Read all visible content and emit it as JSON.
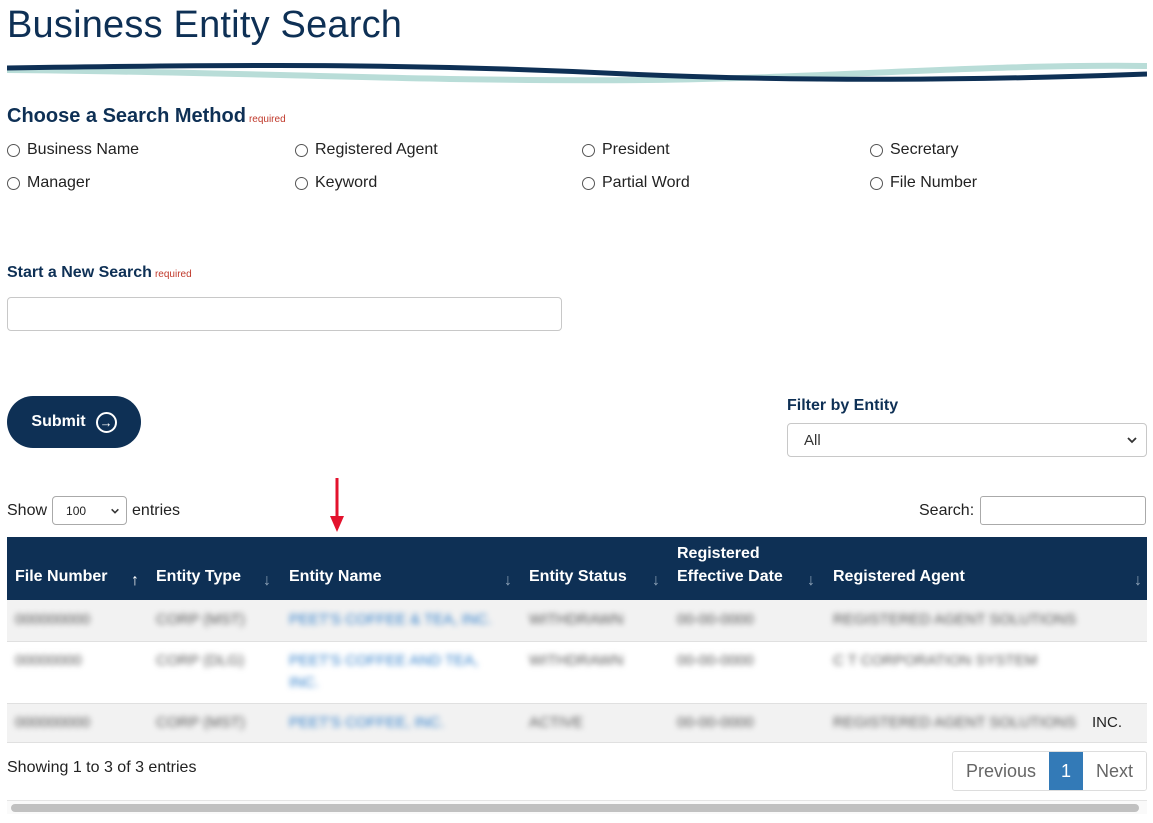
{
  "page": {
    "title": "Business Entity Search"
  },
  "search_method": {
    "title": "Choose a Search Method",
    "required": "required",
    "options": [
      "Business Name",
      "Registered Agent",
      "President",
      "Secretary",
      "Manager",
      "Keyword",
      "Partial Word",
      "File Number"
    ]
  },
  "new_search": {
    "label": "Start a New Search",
    "required": "required",
    "value": ""
  },
  "submit": {
    "label": "Submit"
  },
  "filter": {
    "label": "Filter by Entity",
    "selected": "All"
  },
  "length": {
    "show": "Show",
    "selected": "100",
    "entries": "entries"
  },
  "table_search": {
    "label": "Search:",
    "value": ""
  },
  "table": {
    "columns": [
      {
        "label": "File Number",
        "sort": "asc"
      },
      {
        "label": "Entity Type",
        "sort": "none"
      },
      {
        "label": "Entity Name",
        "sort": "none"
      },
      {
        "label": "Entity Status",
        "sort": "none"
      },
      {
        "label_line1": "Registered",
        "label_line2": "Effective Date",
        "sort": "none"
      },
      {
        "label": "Registered Agent",
        "sort": "none"
      }
    ],
    "rows": [
      {
        "file_number": "000000000",
        "entity_type": "CORP (MST)",
        "entity_name": "PEET'S COFFEE & TEA, INC.",
        "entity_status": "WITHDRAWN",
        "effective_date": "00-00-0000",
        "agent": "REGISTERED AGENT SOLUTIONS"
      },
      {
        "file_number": "00000000",
        "entity_type": "CORP (DLG)",
        "entity_name": "PEET'S COFFEE AND TEA,",
        "entity_name_2": "INC.",
        "entity_status": "WITHDRAWN",
        "effective_date": "00-00-0000",
        "agent": "C T CORPORATION SYSTEM"
      },
      {
        "file_number": "000000000",
        "entity_type": "CORP (MST)",
        "entity_name": "PEET'S COFFEE, INC.",
        "entity_status": "ACTIVE",
        "effective_date": "00-00-0000",
        "agent": "REGISTERED AGENT SOLUTIONS",
        "agent_suffix": "INC."
      }
    ]
  },
  "info": "Showing 1 to 3 of 3 entries",
  "pagination": {
    "previous": "Previous",
    "current": "1",
    "next": "Next"
  },
  "icons": {
    "submit": "arrow-right-circle-icon",
    "sort_asc": "↑",
    "sort_desc": "↓",
    "annotation": "red-arrow-down"
  },
  "colors": {
    "navy": "#0e3055",
    "teal_wave": "#b9ddd8",
    "link": "#2c7cc9",
    "pager_active": "#337ab7",
    "annotation": "#e3122d"
  }
}
